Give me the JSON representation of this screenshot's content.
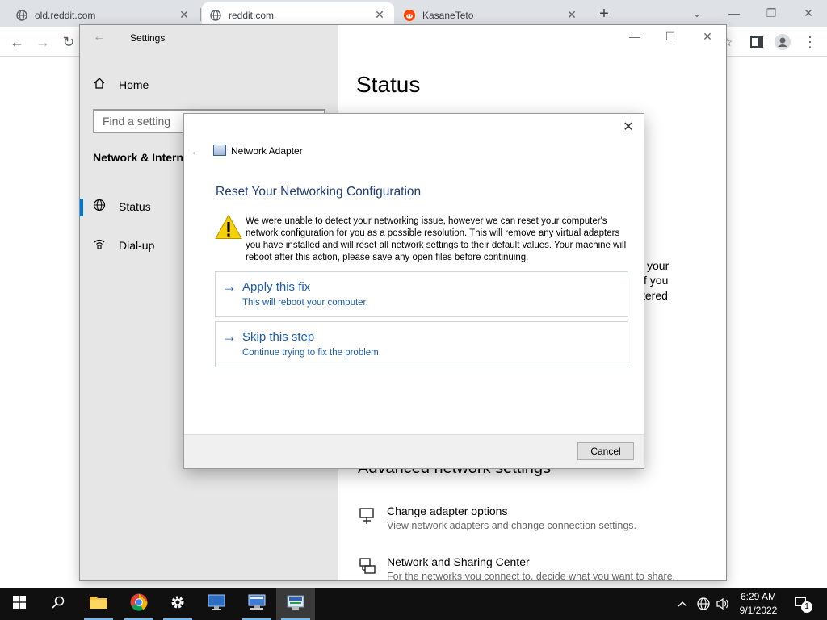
{
  "browser": {
    "tabs": [
      {
        "label": "old.reddit.com",
        "icon": "globe-icon"
      },
      {
        "label": "reddit.com",
        "icon": "globe-icon"
      },
      {
        "label": "KasaneTeto",
        "icon": "reddit-icon"
      }
    ],
    "tab_close": "✕",
    "new_tab": "+"
  },
  "settings": {
    "window_title": "Settings",
    "home": "Home",
    "search_placeholder": "Find a setting",
    "section": "Network & Interne",
    "nav": [
      {
        "label": "Status",
        "icon": "globe-icon",
        "selected": true
      },
      {
        "label": "Dial-up",
        "icon": "dialup-icon",
        "selected": false
      }
    ],
    "page_title": "Status",
    "obscured_text": [
      "your",
      "f you",
      "tered"
    ],
    "advanced_heading": "Advanced network settings",
    "links": [
      {
        "title": "Change adapter options",
        "desc": "View network adapters and change connection settings.",
        "icon": "adapter-icon"
      },
      {
        "title": "Network and Sharing Center",
        "desc": "For the networks you connect to, decide what you want to share.",
        "icon": "sharing-center-icon"
      }
    ]
  },
  "dialog": {
    "app_title": "Network Adapter",
    "heading": "Reset Your Networking Configuration",
    "message": "We were unable to detect your networking issue, however we can reset your computer's network configuration for you as a possible resolution. This will remove any virtual adapters you have installed and will reset all network settings to their default values. Your machine will reboot after this action, please save any open files before continuing.",
    "options": [
      {
        "title": "Apply this fix",
        "desc": "This will reboot your computer."
      },
      {
        "title": "Skip this step",
        "desc": "Continue trying to fix the problem."
      }
    ],
    "cancel": "Cancel"
  },
  "taskbar": {
    "time": "6:29 AM",
    "date": "9/1/2022",
    "notification_count": "1"
  },
  "colors": {
    "accent": "#0078d7",
    "link_blue": "#1c5cab",
    "heading_blue": "#1e3c78",
    "sidebar_bg": "#e6e6e6",
    "taskbar_bg": "#101010"
  }
}
